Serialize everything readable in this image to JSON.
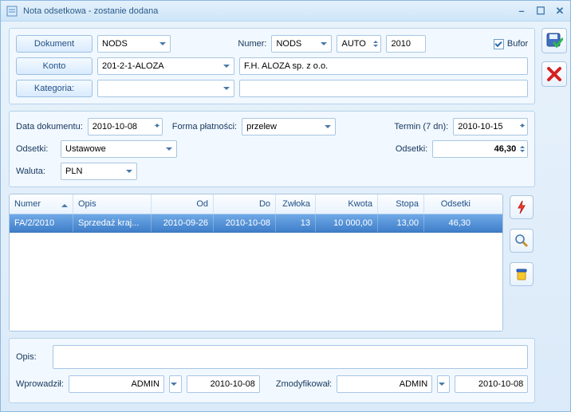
{
  "window": {
    "title": "Nota odsetkowa - zostanie dodana"
  },
  "header": {
    "dokument_btn": "Dokument",
    "dokument_val": "NODS",
    "numer_lbl": "Numer:",
    "numer_series": "NODS",
    "numer_mode": "AUTO",
    "numer_year": "2010",
    "bufor_lbl": "Bufor",
    "konto_btn": "Konto",
    "konto_val": "201-2-1-ALOZA",
    "konto_name": "F.H. ALOZA sp. z o.o.",
    "kategoria_btn": "Kategoria:",
    "kategoria_val": "",
    "kategoria_name": ""
  },
  "params": {
    "data_dok_lbl": "Data dokumentu:",
    "data_dok": "2010-10-08",
    "forma_lbl": "Forma płatności:",
    "forma_val": "przelew",
    "termin_lbl": "Termin (7 dn):",
    "termin_val": "2010-10-15",
    "odsetki_type_lbl": "Odsetki:",
    "odsetki_type": "Ustawowe",
    "odsetki_sum_lbl": "Odsetki:",
    "odsetki_sum": "46,30",
    "waluta_lbl": "Waluta:",
    "waluta_val": "PLN"
  },
  "grid": {
    "cols": {
      "numer": "Numer",
      "opis": "Opis",
      "od": "Od",
      "do": "Do",
      "zwloka": "Zwłoka",
      "kwota": "Kwota",
      "stopa": "Stopa",
      "odsetki": "Odsetki"
    },
    "rows": [
      {
        "numer": "FA/2/2010",
        "opis": "Sprzedaż kraj...",
        "od": "2010-09-26",
        "do": "2010-10-08",
        "zwloka": "13",
        "kwota": "10 000,00",
        "stopa": "13,00",
        "odsetki": "46,30"
      }
    ]
  },
  "opis": {
    "label": "Opis:",
    "value": ""
  },
  "audit": {
    "wprowadzil_lbl": "Wprowadził:",
    "wprowadzil_user": "ADMIN",
    "wprowadzil_date": "2010-10-08",
    "zmodyfikowal_lbl": "Zmodyfikował:",
    "zmodyfikowal_user": "ADMIN",
    "zmodyfikowal_date": "2010-10-08"
  }
}
